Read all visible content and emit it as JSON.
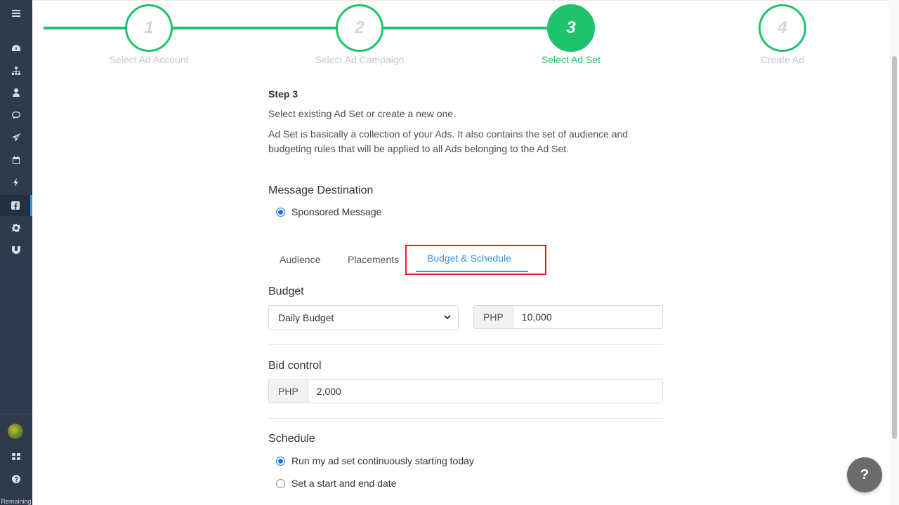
{
  "sidebar": {
    "icons": [
      "menu-icon",
      "dashboard-icon",
      "sitemap-icon",
      "user-icon",
      "chat-icon",
      "send-icon",
      "calendar-icon",
      "bolt-icon",
      "facebook-icon",
      "gear-icon",
      "magnet-icon"
    ],
    "active": "facebook-icon",
    "bottom_icons": [
      "avatar",
      "grid-icon",
      "help-circle-icon"
    ],
    "remaining_label": "Remaining"
  },
  "stepper": {
    "steps": [
      {
        "number": "1",
        "label": "Select Ad Account"
      },
      {
        "number": "2",
        "label": "Select Ad Campaign"
      },
      {
        "number": "3",
        "label": "Select Ad Set"
      },
      {
        "number": "4",
        "label": "Create Ad"
      }
    ],
    "current_step": 3,
    "accent_color": "#1ec36b"
  },
  "content": {
    "heading": "Step 3",
    "desc1": "Select existing Ad Set or create a new one.",
    "desc2": "Ad Set is basically a collection of your Ads. It also contains the set of audience and budgeting rules that will be applied to all Ads belonging to the Ad Set."
  },
  "destination": {
    "title": "Message Destination",
    "option": "Sponsored Message"
  },
  "tabs": {
    "items": [
      "Audience",
      "Placements",
      "Budget & Schedule"
    ],
    "active": "Budget & Schedule"
  },
  "budget": {
    "title": "Budget",
    "type_value": "Daily Budget",
    "currency": "PHP",
    "amount": "10,000"
  },
  "bid": {
    "title": "Bid control",
    "currency": "PHP",
    "amount": "2,000"
  },
  "schedule": {
    "title": "Schedule",
    "options": [
      "Run my ad set continuously starting today",
      "Set a start and end date"
    ],
    "selected": "Run my ad set continuously starting today"
  },
  "help": {
    "label": "?"
  }
}
